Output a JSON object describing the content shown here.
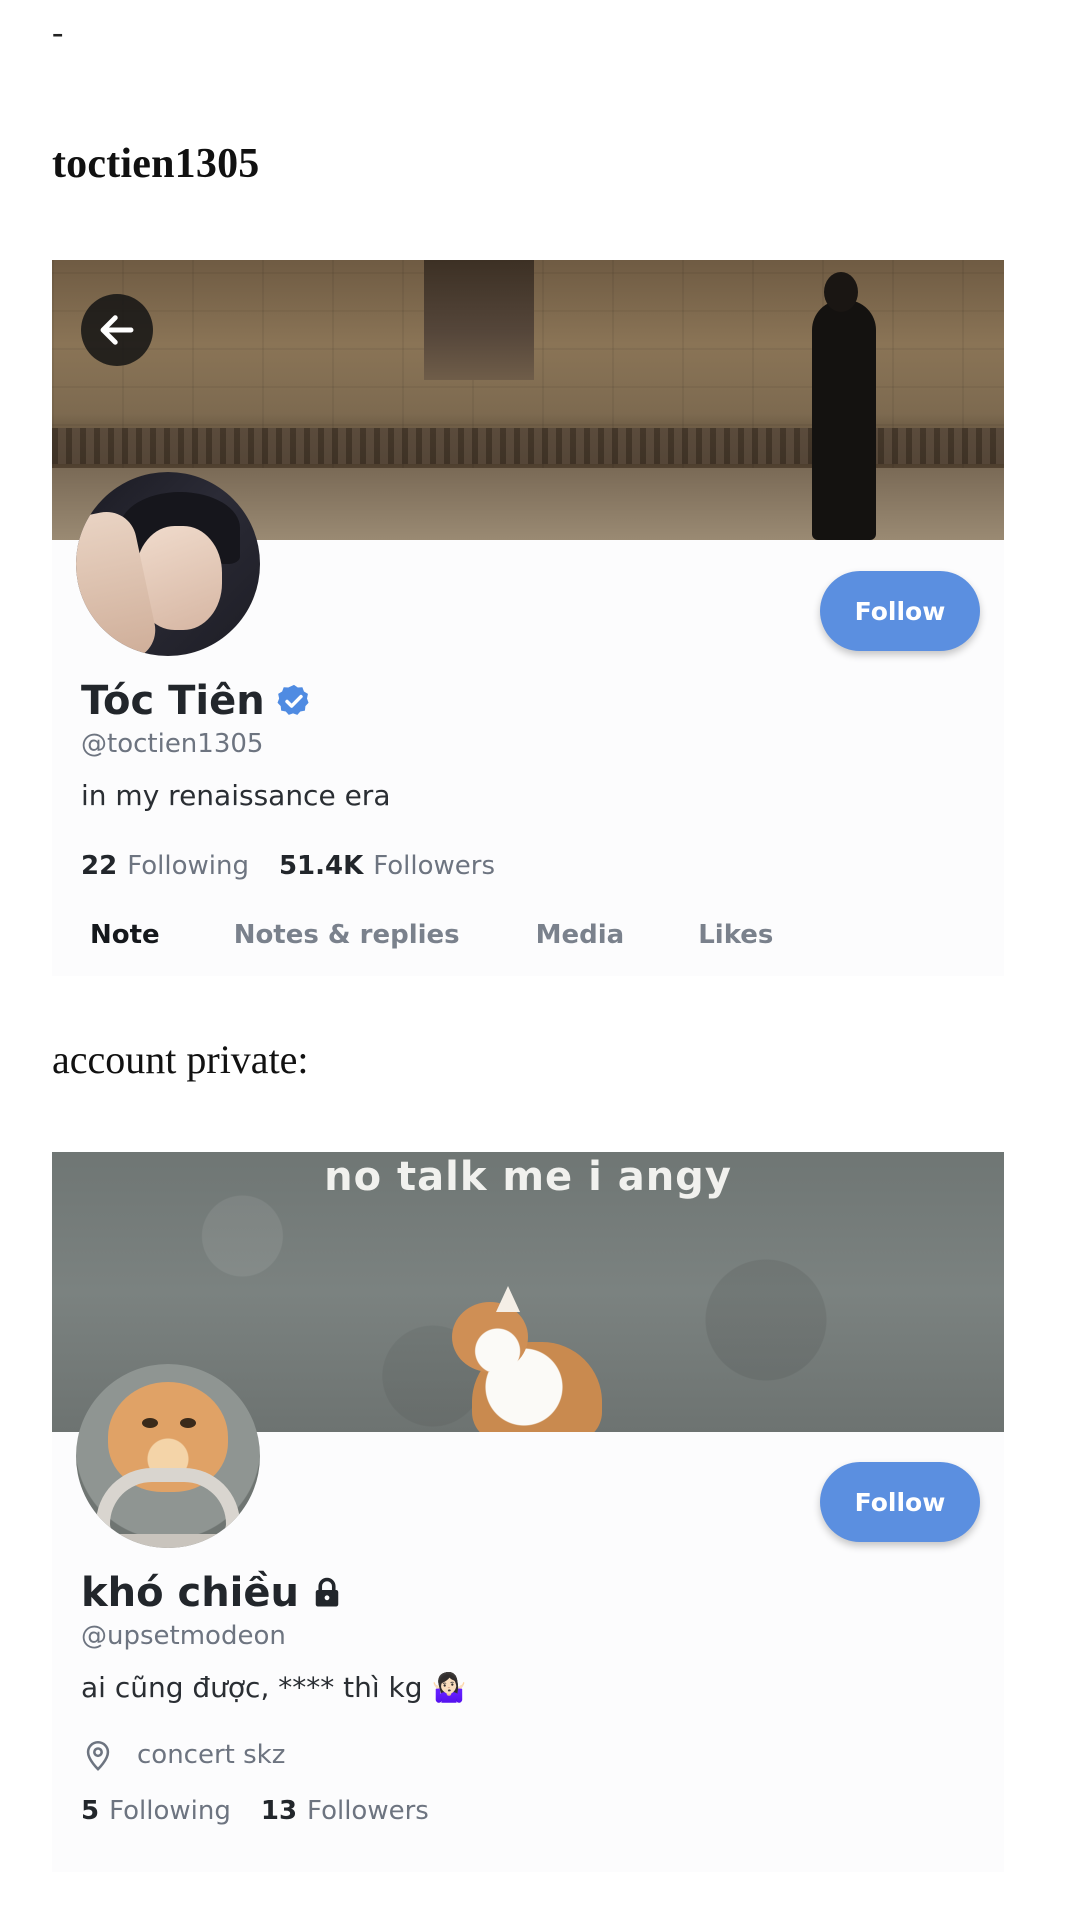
{
  "header": {
    "dash": "-",
    "title": "toctien1305"
  },
  "section_label": "account private:",
  "profiles": [
    {
      "display_name": "Tóc Tiên",
      "badge_icon": "verified-badge-icon",
      "handle": "@toctien1305",
      "bio": "in my renaissance era",
      "follow_label": "Follow",
      "following_count": "22",
      "following_label": "Following",
      "followers_count": "51.4K",
      "followers_label": "Followers",
      "tabs": [
        "Note",
        "Notes & replies",
        "Media",
        "Likes"
      ],
      "active_tab": "Note"
    },
    {
      "display_name": "khó chiều",
      "badge_icon": "lock-icon",
      "handle": "@upsetmodeon",
      "bio": "ai cũng được, **** thì kg 🤷🏻‍♀️",
      "banner_caption": "no talk me i angy",
      "location": "concert skz",
      "follow_label": "Follow",
      "following_count": "5",
      "following_label": "Following",
      "followers_count": "13",
      "followers_label": "Followers"
    }
  ],
  "colors": {
    "accent": "#5b8fe0",
    "verified": "#4f8be2",
    "muted_text": "#6d7480",
    "primary_text": "#22262b"
  }
}
